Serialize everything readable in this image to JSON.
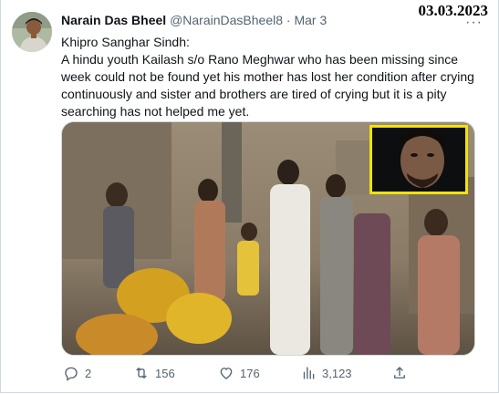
{
  "stamp": {
    "date": "03.03.2023"
  },
  "tweet": {
    "author_name": "Narain Das Bheel",
    "handle": "@NarainDasBheel8",
    "separator": "·",
    "time": "Mar 3",
    "more": "···",
    "lines": [
      "Khipro Sanghar Sindh:",
      "A hindu youth Kailash s/o  Rano Meghwar who has been missing since",
      "week could not be found yet his mother has lost her condition after crying",
      "continuously and sister and brothers are tired of crying but it is a pity",
      "searching has not helped me yet."
    ]
  },
  "actions": {
    "replies": "2",
    "retweets": "156",
    "likes": "176",
    "views": "3,123"
  },
  "icons": [
    "reply-icon",
    "retweet-icon",
    "like-icon",
    "views-icon",
    "share-icon",
    "more-icon"
  ]
}
